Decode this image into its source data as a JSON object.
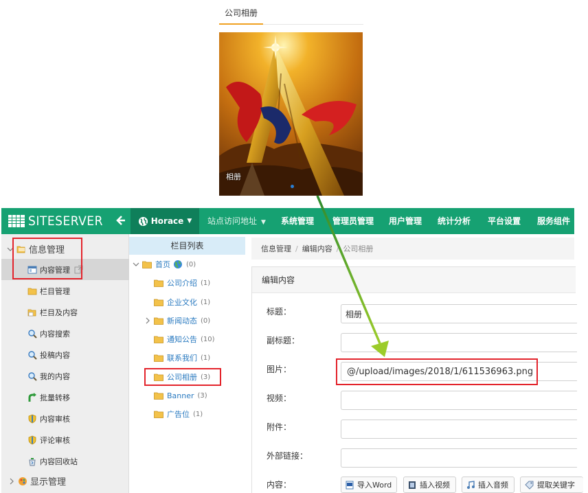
{
  "preview": {
    "tab_label": "公司相册",
    "image_caption": "相册"
  },
  "header": {
    "logo_text": "SITESERVER",
    "site_button": "Horace",
    "nav": [
      "站点访问地址",
      "系统管理",
      "管理员管理",
      "用户管理",
      "统计分析",
      "平台设置",
      "服务组件"
    ]
  },
  "sidebar": {
    "group_info": "信息管理",
    "items": [
      "内容管理",
      "栏目管理",
      "栏目及内容",
      "内容搜索",
      "投稿内容",
      "我的内容",
      "批量转移",
      "内容审核",
      "评论审核",
      "内容回收站"
    ],
    "group_display": "显示管理"
  },
  "tree": {
    "header": "栏目列表",
    "root": {
      "label": "首页",
      "count": "(0)"
    },
    "rows": [
      {
        "label": "公司介绍",
        "count": "(1)"
      },
      {
        "label": "企业文化",
        "count": "(1)"
      },
      {
        "label": "新闻动态",
        "count": "(0)"
      },
      {
        "label": "通知公告",
        "count": "(10)"
      },
      {
        "label": "联系我们",
        "count": "(1)"
      },
      {
        "label": "公司相册",
        "count": "(3)"
      },
      {
        "label": "Banner",
        "count": "(3)"
      },
      {
        "label": "广告位",
        "count": "(1)"
      }
    ]
  },
  "breadcrumb": [
    "信息管理",
    "编辑内容",
    "公司相册"
  ],
  "panel": {
    "title": "编辑内容",
    "fields": [
      {
        "label": "标题：",
        "value": "相册"
      },
      {
        "label": "副标题：",
        "value": ""
      },
      {
        "label": "图片：",
        "value": "@/upload/images/2018/1/611536963.png"
      },
      {
        "label": "视频：",
        "value": ""
      },
      {
        "label": "附件：",
        "value": ""
      },
      {
        "label": "外部链接：",
        "value": ""
      }
    ],
    "content_label": "内容：",
    "tools": [
      "导入Word",
      "插入视频",
      "插入音频",
      "提取关键字"
    ]
  },
  "colors": {
    "header_green": "#16a172",
    "site_button_green": "#0f7f5a",
    "highlight_red": "#e3232b",
    "arrow_green": "#8cc63f",
    "link_blue": "#2a7ac0"
  }
}
